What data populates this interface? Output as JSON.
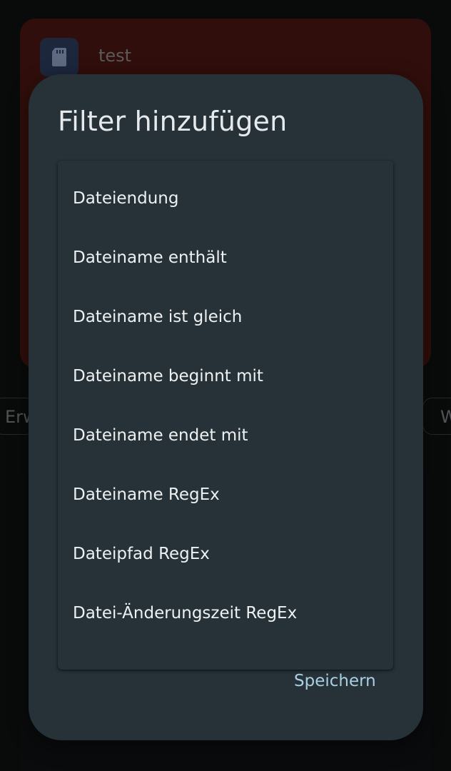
{
  "background": {
    "card_title": "test",
    "chip_left_label": "Erw",
    "chip_right_label": "W",
    "card_icon": "sd-card-icon"
  },
  "dialog": {
    "title": "Filter hinzufügen",
    "options": [
      "Dateiendung",
      "Dateiname enthält",
      "Dateiname ist gleich",
      "Dateiname beginnt mit",
      "Dateiname endet mit",
      "Dateiname RegEx",
      "Dateipfad RegEx",
      "Datei-Änderungszeit RegEx"
    ],
    "save_label": "Speichern"
  },
  "colors": {
    "dialog_bg": "#263238",
    "accent": "#a9cfe3",
    "card_bg": "#4a1611"
  }
}
